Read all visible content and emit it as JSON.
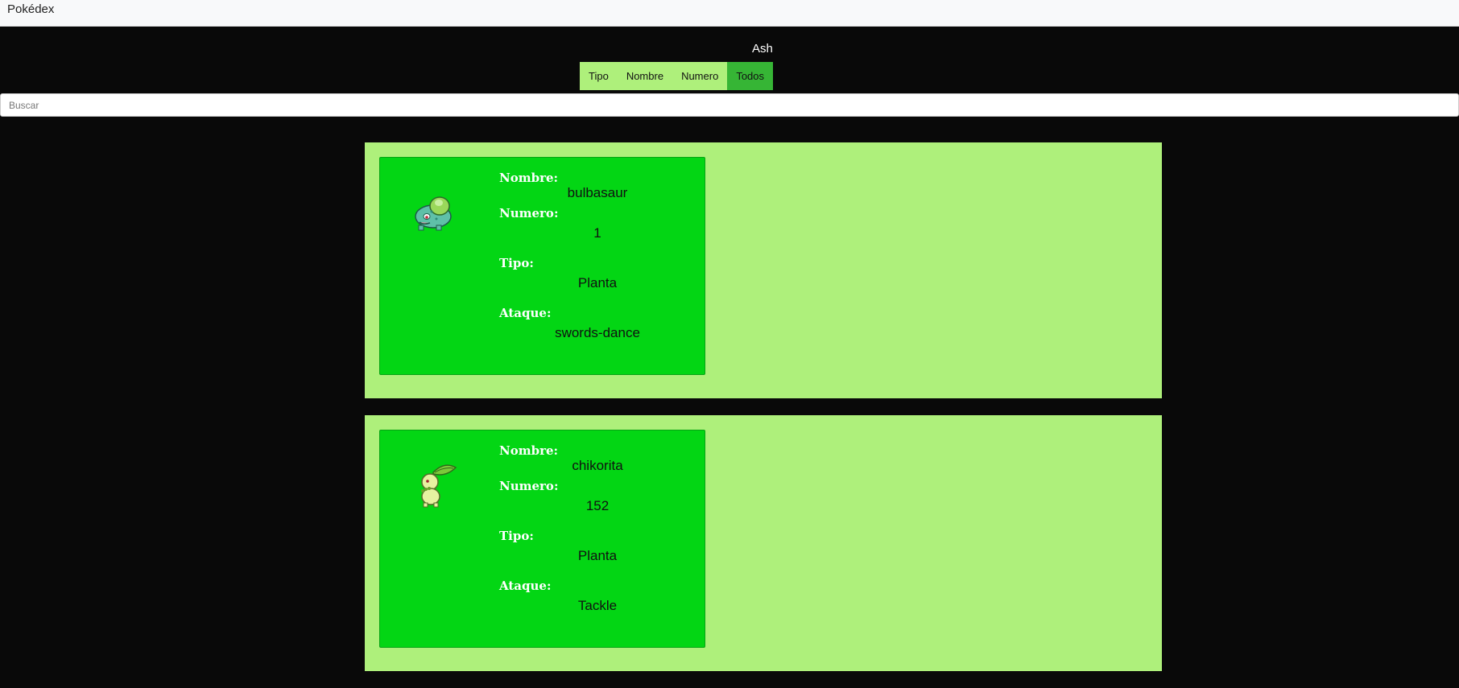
{
  "navbar": {
    "brand": "Pokédex"
  },
  "user": {
    "name": "Ash"
  },
  "filters": [
    {
      "label": "Tipo",
      "active": false
    },
    {
      "label": "Nombre",
      "active": false
    },
    {
      "label": "Numero",
      "active": false
    },
    {
      "label": "Todos",
      "active": true
    }
  ],
  "search": {
    "placeholder": "Buscar",
    "value": ""
  },
  "field_labels": {
    "name": "Nombre:",
    "number": "Numero:",
    "type": "Tipo:",
    "attack": "Ataque:"
  },
  "pokemon": [
    {
      "sprite_icon": "bulbasaur-sprite-icon",
      "name": "bulbasaur",
      "number": "1",
      "type": "Planta",
      "attack": "swords-dance"
    },
    {
      "sprite_icon": "chikorita-sprite-icon",
      "name": "chikorita",
      "number": "152",
      "type": "Planta",
      "attack": "Tackle"
    }
  ],
  "colors": {
    "background": "#090909",
    "panel": "#aef07b",
    "card": "#03d614",
    "filter_active": "#36b535",
    "filter": "#aef07b"
  }
}
